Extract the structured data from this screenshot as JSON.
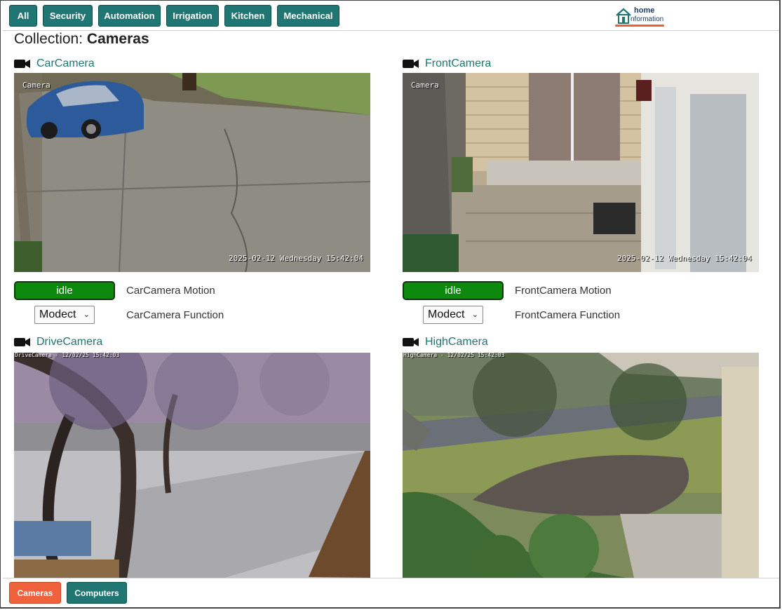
{
  "nav": {
    "tabs": [
      "All",
      "Security",
      "Automation",
      "Irrigation",
      "Kitchen",
      "Mechanical"
    ]
  },
  "logo": {
    "line1": "home",
    "line2": "nformation"
  },
  "collection": {
    "prefix": "Collection:",
    "name": "Cameras"
  },
  "cameras": [
    {
      "name": "CarCamera",
      "overlay_label": "Camera",
      "timestamp": "2025-02-12 Wednesday 15:42:04",
      "status": "idle",
      "motion_label": "CarCamera Motion",
      "function_value": "Modect",
      "function_label": "CarCamera Function"
    },
    {
      "name": "FrontCamera",
      "overlay_label": "Camera",
      "timestamp": "2025-02-12 Wednesday 15:42:04",
      "status": "idle",
      "motion_label": "FrontCamera Motion",
      "function_value": "Modect",
      "function_label": "FrontCamera Function"
    },
    {
      "name": "DriveCamera",
      "overlay_label": "DriveCamera - 12/02/25 15:42:03"
    },
    {
      "name": "HighCamera",
      "overlay_label": "HighCamera - 12/02/25 15:42:03"
    }
  ],
  "footer": {
    "tabs": [
      "Cameras",
      "Computers"
    ]
  },
  "colors": {
    "primary": "#1f7672",
    "active": "#f0623c",
    "status_ok": "#0d8a0d",
    "link": "#1f7672"
  },
  "icons": [
    "camera-icon",
    "house-icon",
    "chevron-down-icon"
  ]
}
